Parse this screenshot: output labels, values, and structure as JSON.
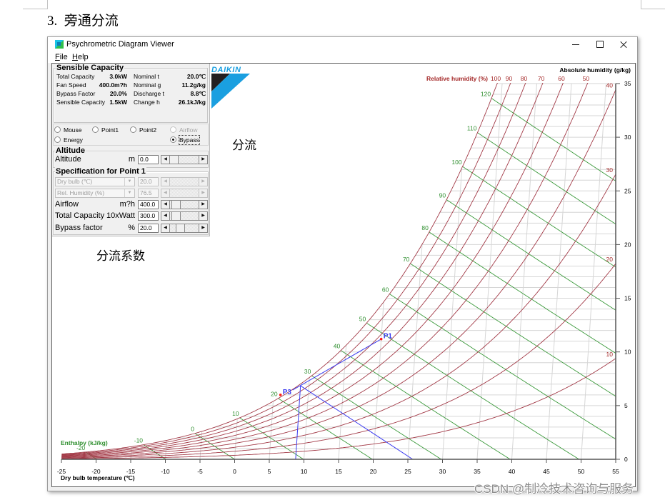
{
  "document": {
    "heading": "3.  旁通分流",
    "annotations": {
      "bypass_split": "分流",
      "bypass_factor": "分流系数"
    },
    "watermark": "CSDN @制冷技术咨询与服务"
  },
  "window": {
    "title": "Psychrometric Diagram Viewer",
    "icon": "app-icon",
    "controls": [
      "minimize-icon",
      "maximize-icon",
      "close-icon"
    ]
  },
  "menu": [
    {
      "label": "File"
    },
    {
      "label": "Help"
    }
  ],
  "panel": {
    "sensible": {
      "title": "Sensible Capacity",
      "rows": [
        {
          "label": "Total Capacity",
          "value": "3.0kW",
          "label2": "Nominal t",
          "value2": "20.0℃"
        },
        {
          "label": "Fan Speed",
          "value": "400.0m?h",
          "label2": "Nominal g",
          "value2": "11.2g/kg"
        },
        {
          "label": "Bypass Factor",
          "value": "20.0%",
          "label2": "Discharge t",
          "value2": "8.8℃"
        },
        {
          "label": "Sensible Capacity",
          "value": "1.5kW",
          "label2": "Change h",
          "value2": "26.1kJ/kg"
        }
      ]
    },
    "radios": [
      {
        "label": "Mouse",
        "checked": false,
        "enabled": true
      },
      {
        "label": "Point1",
        "checked": false,
        "enabled": true
      },
      {
        "label": "Point2",
        "checked": false,
        "enabled": true
      },
      {
        "label": "Airflow",
        "checked": false,
        "enabled": false
      },
      {
        "label": "Energy",
        "checked": false,
        "enabled": true
      },
      {
        "label": "Bypass",
        "checked": true,
        "enabled": true
      }
    ],
    "altitude": {
      "title": "Altitude",
      "label": "Altitude",
      "unit": "m",
      "value": "0.0",
      "slider": 0.0
    },
    "spec": {
      "title": "Specification for Point 1",
      "rows": [
        {
          "select": "Dry bulb (℃)",
          "value": "20.0",
          "enabled": false
        },
        {
          "select": "Rel. Humidity (%)",
          "value": "76.5",
          "enabled": false
        },
        {
          "label": "Airflow",
          "unit": "m?h",
          "value": "400.0",
          "slider": 0.09,
          "enabled": true
        },
        {
          "label": "Total Capacity",
          "unit": "10xWatt",
          "value": "300.0",
          "slider": 0.09,
          "enabled": true
        },
        {
          "label": "Bypass factor",
          "unit": "%",
          "value": "20.0",
          "slider": 0.32,
          "enabled": true
        }
      ]
    }
  },
  "logo": {
    "text": "DAIKIN",
    "blue": "#1a9fe0",
    "black": "#231f20"
  },
  "chart_data": {
    "type": "line",
    "title": "",
    "xlabel": "Dry bulb temperature (℃)",
    "ylabel": "Absolute humidity (g/kg)",
    "xlim": [
      -25,
      55
    ],
    "ylim": [
      0,
      35
    ],
    "xticks": [
      -25,
      -20,
      -15,
      -10,
      -5,
      0,
      5,
      10,
      15,
      20,
      25,
      30,
      35,
      40,
      45,
      50,
      55
    ],
    "yticks": [
      0,
      5,
      10,
      15,
      20,
      25,
      30,
      35
    ],
    "grid": true,
    "relative_humidity": {
      "label": "Relative humidity (%)",
      "values": [
        10,
        20,
        30,
        40,
        50,
        60,
        70,
        80,
        90,
        100
      ]
    },
    "enthalpy": {
      "label": "Enthalpy (kJ/kg)",
      "values": [
        -20,
        -10,
        0,
        10,
        20,
        30,
        40,
        50,
        60,
        70,
        80,
        90,
        100,
        110,
        120
      ]
    },
    "points": [
      {
        "name": "P1",
        "t": 20.0,
        "w": 11.2
      },
      {
        "name": "P3",
        "t": 6.0,
        "w": 6.0
      }
    ],
    "process_lines": [
      {
        "name": "bypass-mixing-line",
        "from": [
          20.0,
          11.2
        ],
        "to": [
          7.7,
          6.45
        ]
      },
      {
        "name": "discharge-dry-bulb-line",
        "from": [
          8.8,
          6.85
        ],
        "to": [
          8.8,
          0
        ]
      },
      {
        "name": "discharge-enthalpy-line",
        "from": [
          8.8,
          6.85
        ],
        "to": [
          25.7,
          0
        ]
      }
    ],
    "colors": {
      "rh": "#a33b48",
      "rh_label": "#a52a2a",
      "enthalpy": "#3c9a3c",
      "enthalpy_label": "#2f8f2f",
      "process": "#3b3bf0",
      "point": "#ff1a1a",
      "grid": "#d6d6d6",
      "axis": "#555555"
    }
  }
}
